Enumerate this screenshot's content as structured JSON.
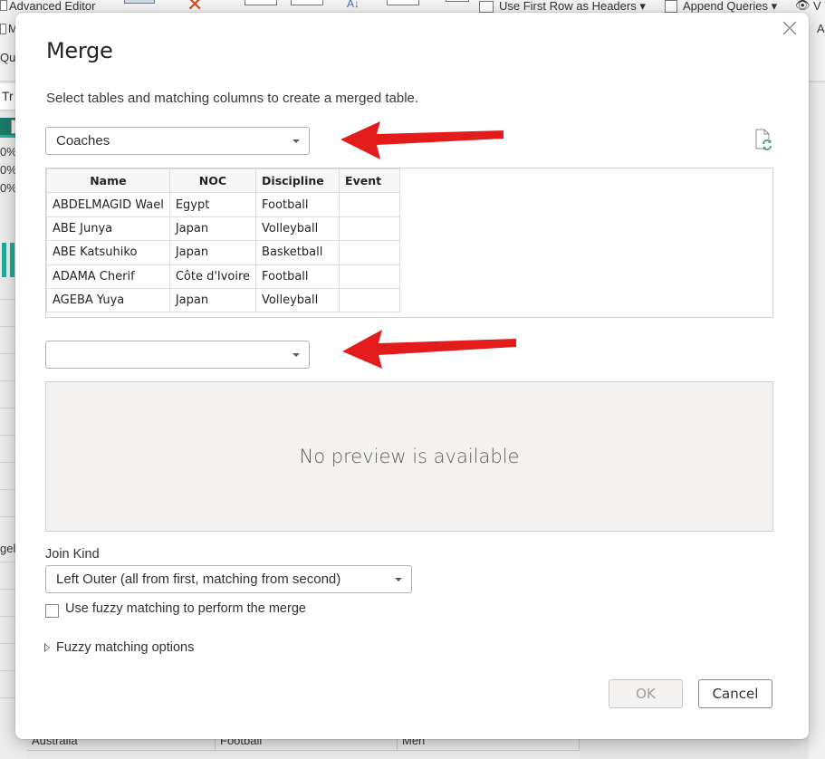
{
  "background_app": {
    "ribbon": {
      "advanced_editor": "Advanced Editor",
      "use_first_row": "Use First Row as Headers",
      "append_queries": "Append Queries",
      "truncated_left_1": "M",
      "truncated_left_2": "Qu",
      "truncated_right_1": "V",
      "truncated_right_2": "A"
    },
    "formula_bar": {
      "left_text": "Tr",
      "right_text": "},"
    },
    "left_panel": {
      "percent_values": [
        "0%",
        "0%",
        "0%"
      ],
      "row_text": "gel"
    },
    "bottom_row": [
      "Australia",
      "Football",
      "Men"
    ]
  },
  "dialog": {
    "title": "Merge",
    "subtitle": "Select tables and matching columns to create a merged table.",
    "first_table": {
      "selected": "Coaches",
      "columns": [
        "Name",
        "NOC",
        "Discipline",
        "Event"
      ],
      "rows": [
        [
          "ABDELMAGID Wael",
          "Egypt",
          "Football",
          ""
        ],
        [
          "ABE Junya",
          "Japan",
          "Volleyball",
          ""
        ],
        [
          "ABE Katsuhiko",
          "Japan",
          "Basketball",
          ""
        ],
        [
          "ADAMA Cherif",
          "Côte d'Ivoire",
          "Football",
          ""
        ],
        [
          "AGEBA Yuya",
          "Japan",
          "Volleyball",
          ""
        ]
      ]
    },
    "second_table": {
      "selected": "",
      "empty_message": "No preview is available"
    },
    "join_kind": {
      "label": "Join Kind",
      "selected": "Left Outer (all from first, matching from second)"
    },
    "fuzzy": {
      "checkbox_label": "Use fuzzy matching to perform the merge",
      "checked": false,
      "options_label": "Fuzzy matching options"
    },
    "buttons": {
      "ok": "OK",
      "cancel": "Cancel"
    },
    "colors": {
      "annotation_arrow": "#e31b1b",
      "refresh_icon": "#3c9a5f"
    }
  }
}
